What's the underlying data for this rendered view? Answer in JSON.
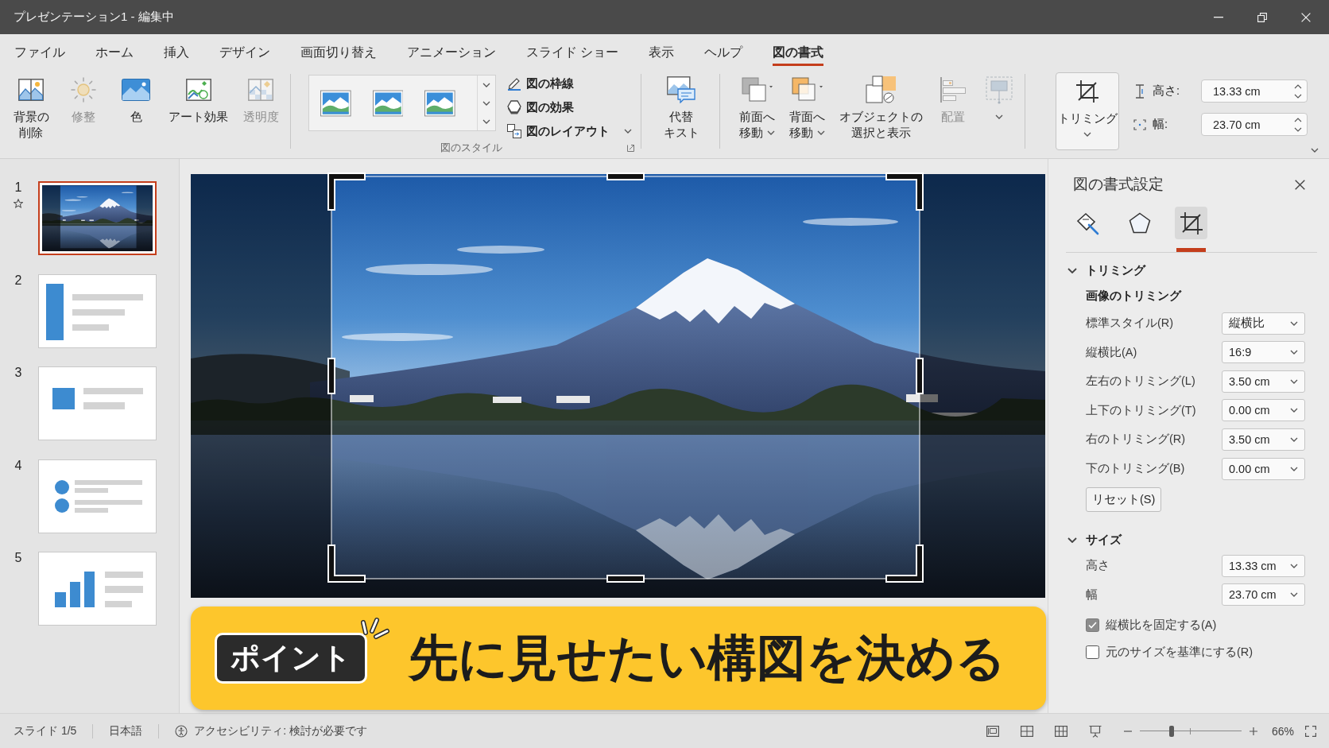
{
  "window": {
    "title": "プレゼンテーション1 - 編集中"
  },
  "menu_tabs": [
    {
      "label": "ファイル",
      "selected": false
    },
    {
      "label": "ホーム",
      "selected": false
    },
    {
      "label": "挿入",
      "selected": false
    },
    {
      "label": "デザイン",
      "selected": false
    },
    {
      "label": "画面切り替え",
      "selected": false
    },
    {
      "label": "アニメーション",
      "selected": false
    },
    {
      "label": "スライド ショー",
      "selected": false
    },
    {
      "label": "表示",
      "selected": false
    },
    {
      "label": "ヘルプ",
      "selected": false
    },
    {
      "label": "図の書式",
      "selected": true
    }
  ],
  "ribbon": {
    "adjust": [
      {
        "kind": "remove-background",
        "label_lines": [
          "背景の",
          "削除"
        ],
        "disabled": false
      },
      {
        "kind": "corrections",
        "label_lines": [
          "修整"
        ],
        "disabled": true
      },
      {
        "kind": "color",
        "label_lines": [
          "色"
        ],
        "disabled": false
      },
      {
        "kind": "artistic-effects",
        "label_lines": [
          "アート効果"
        ],
        "disabled": false
      },
      {
        "kind": "transparency",
        "label_lines": [
          "透明度"
        ],
        "disabled": true
      }
    ],
    "picture_styles": {
      "label": "図のスタイル",
      "commands": [
        {
          "kind": "border",
          "label": "図の枠線",
          "dropdown": false
        },
        {
          "kind": "effects",
          "label": "図の効果",
          "dropdown": false
        },
        {
          "kind": "layout",
          "label": "図のレイアウト",
          "dropdown": true
        }
      ]
    },
    "accessibility": [
      {
        "kind": "alt-text",
        "label_lines": [
          "代替",
          "キスト"
        ],
        "disabled": false
      }
    ],
    "arrange": [
      {
        "kind": "bring-forward",
        "label_lines": [
          "前面へ",
          "移動"
        ],
        "disabled": false,
        "dropdown": true
      },
      {
        "kind": "send-backward",
        "label_lines": [
          "背面へ",
          "移動"
        ],
        "disabled": false,
        "dropdown": true
      },
      {
        "kind": "selection-pane",
        "label_lines": [
          "オブジェクトの",
          "選択と表示"
        ],
        "disabled": false,
        "dropdown": false
      },
      {
        "kind": "align",
        "label_lines": [
          "配置"
        ],
        "disabled": true,
        "dropdown": false
      },
      {
        "kind": "group",
        "disabled": true,
        "dropdown": true
      }
    ],
    "crop": {
      "label": "トリミング",
      "pressed": true,
      "dropdown": true
    },
    "size_fields": [
      {
        "kind": "height",
        "label": "高さ:",
        "value": "13.33 cm"
      },
      {
        "kind": "width",
        "label": "幅:",
        "value": "23.70 cm"
      }
    ]
  },
  "slides": [
    {
      "number": "1",
      "kind": "photo",
      "selected": true,
      "transition": true
    },
    {
      "number": "2",
      "kind": "bar-text",
      "selected": false,
      "transition": false
    },
    {
      "number": "3",
      "kind": "square-text",
      "selected": false,
      "transition": false
    },
    {
      "number": "4",
      "kind": "bullets",
      "selected": false,
      "transition": false
    },
    {
      "number": "5",
      "kind": "chart-text",
      "selected": false,
      "transition": false
    }
  ],
  "editor": {
    "crop_mode": true
  },
  "callout": {
    "badge": "ポイント",
    "text": "先に見せたい構図を決める"
  },
  "format_pane": {
    "title": "図の書式設定",
    "tabs": [
      {
        "kind": "fill-line",
        "selected": false
      },
      {
        "kind": "effects",
        "selected": false
      },
      {
        "kind": "crop",
        "selected": true
      }
    ],
    "sections": [
      {
        "title": "トリミング",
        "expanded": true,
        "items": [
          {
            "kind": "heading",
            "label": "画像のトリミング"
          },
          {
            "kind": "dropdown",
            "label": "標準スタイル(R)",
            "value": "縦横比"
          },
          {
            "kind": "dropdown",
            "label": "縦横比(A)",
            "value": "16:9"
          },
          {
            "kind": "dropdown",
            "label": "左右のトリミング(L)",
            "value": "3.50 cm"
          },
          {
            "kind": "dropdown",
            "label": "上下のトリミング(T)",
            "value": "0.00 cm"
          },
          {
            "kind": "dropdown",
            "label": "右のトリミング(R)",
            "value": "3.50 cm"
          },
          {
            "kind": "dropdown",
            "label": "下のトリミング(B)",
            "value": "0.00 cm"
          },
          {
            "kind": "button",
            "label": "リセット(S)"
          }
        ]
      },
      {
        "title": "サイズ",
        "expanded": true,
        "items": [
          {
            "kind": "dropdown",
            "label": "高さ",
            "value": "13.33 cm"
          },
          {
            "kind": "dropdown",
            "label": "幅",
            "value": "23.70 cm"
          },
          {
            "kind": "checkbox",
            "label": "縦横比を固定する(A)",
            "checked": true
          },
          {
            "kind": "checkbox",
            "label": "元のサイズを基準にする(R)",
            "checked": false
          }
        ]
      }
    ]
  },
  "status_bar": {
    "slide_info": "スライド 1/5",
    "language": "日本語",
    "accessibility": "アクセシビリティ: 検討が必要です",
    "zoom": {
      "level": 0.31,
      "percent": "66%"
    }
  }
}
